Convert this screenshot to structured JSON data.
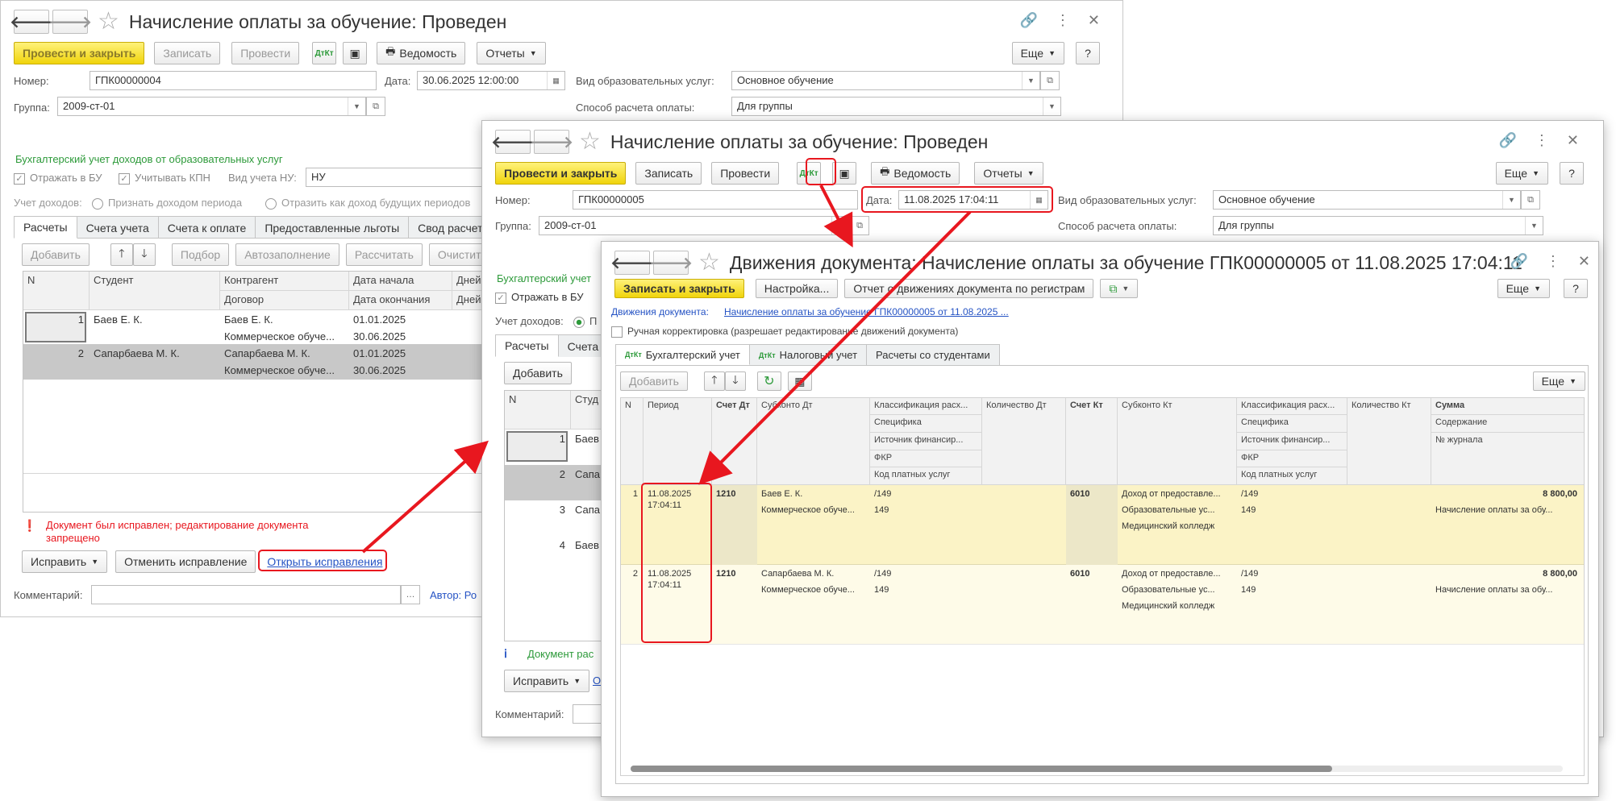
{
  "w1": {
    "title": "Начисление оплаты за обучение: Проведен",
    "btn_post_close": "Провести и закрыть",
    "btn_save": "Записать",
    "btn_post": "Провести",
    "btn_ved": "Ведомость",
    "btn_reports": "Отчеты",
    "btn_more": "Еще",
    "btn_help": "?",
    "lbl_number": "Номер:",
    "number": "ГПК00000004",
    "lbl_date": "Дата:",
    "date": "30.06.2025 12:00:00",
    "lbl_service": "Вид образовательных услуг:",
    "service": "Основное обучение",
    "lbl_group": "Группа:",
    "group": "2009-ст-01",
    "lbl_pay": "Способ расчета оплаты:",
    "pay": "Для группы",
    "section": "Бухгалтерский учет доходов от образовательных услуг",
    "chk_bu": "Отражать в БУ",
    "chk_kpn": "Учитывать КПН",
    "lbl_nu": "Вид учета НУ:",
    "nu": "НУ",
    "lbl_income": "Учет доходов:",
    "radio1": "Признать доходом периода",
    "radio2": "Отразить как доход будущих периодов",
    "tabs": [
      "Расчеты",
      "Счета учета",
      "Счета к оплате",
      "Предоставленные льготы",
      "Свод расчетов"
    ],
    "grid_btns": [
      "Добавить",
      "Подбор",
      "Автозаполнение",
      "Рассчитать",
      "Очистить"
    ],
    "cols": {
      "n": "N",
      "student": "Студент",
      "contr": "Контрагент",
      "contract": "Договор",
      "start": "Дата начала",
      "end": "Дата окончания",
      "days": "Дней"
    },
    "rows": [
      {
        "n": "1",
        "student": "Баев Е. К.",
        "contr": "Баев Е. К.",
        "contract": "Коммерческое обуче...",
        "start": "01.01.2025",
        "end": "30.06.2025"
      },
      {
        "n": "2",
        "student": "Сапарбаева М. К.",
        "contr": "Сапарбаева М. К.",
        "contract": "Коммерческое обуче...",
        "start": "01.01.2025",
        "end": "30.06.2025"
      }
    ],
    "warning": "Документ был исправлен; редактирование документа запрещено",
    "btn_fix": "Исправить",
    "btn_cancel_fix": "Отменить исправление",
    "link_open_fix": "Открыть исправления",
    "lbl_comment": "Комментарий:",
    "author": "Автор: Ро"
  },
  "w2": {
    "title": "Начисление оплаты за обучение: Проведен",
    "btn_post_close": "Провести и закрыть",
    "btn_save": "Записать",
    "btn_post": "Провести",
    "btn_ved": "Ведомость",
    "btn_reports": "Отчеты",
    "btn_more": "Еще",
    "btn_help": "?",
    "lbl_number": "Номер:",
    "number": "ГПК00000005",
    "lbl_date": "Дата:",
    "date": "11.08.2025 17:04:11",
    "lbl_service": "Вид образовательных услуг:",
    "service": "Основное обучение",
    "lbl_group": "Группа:",
    "group": "2009-ст-01",
    "lbl_pay": "Способ расчета оплаты:",
    "pay": "Для группы",
    "section": "Бухгалтерский учет",
    "chk_bu": "Отражать в БУ",
    "lbl_income": "Учет доходов:",
    "radio_short": "П",
    "tabs": [
      "Расчеты",
      "Счета"
    ],
    "btn_add": "Добавить",
    "col_n": "N",
    "col_student": "Студ",
    "rows": [
      {
        "n": "1",
        "s": "Баев"
      },
      {
        "n": "2",
        "s": "Сапа"
      },
      {
        "n": "3",
        "s": "Сапа"
      },
      {
        "n": "4",
        "s": "Баев"
      }
    ],
    "info": "Документ рас",
    "btn_fix": "Исправить",
    "link_short": "О",
    "lbl_comment": "Комментарий:"
  },
  "w3": {
    "title": "Движения документа: Начисление оплаты за обучение ГПК00000005 от 11.08.2025 17:04:11",
    "btn_write_close": "Записать и закрыть",
    "btn_settings": "Настройка...",
    "btn_report": "Отчет о движениях документа по регистрам",
    "btn_more": "Еще",
    "btn_help": "?",
    "lbl_moves": "Движения документа:",
    "link_doc": "Начисление оплаты за обучение ГПК00000005 от 11.08.2025 ...",
    "manual": "Ручная корректировка (разрешает редактирование движений документа)",
    "tabs": [
      "Бухгалтерский учет",
      "Налоговый учет",
      "Расчеты со студентами"
    ],
    "btn_add": "Добавить",
    "cols": {
      "n": "N",
      "period": "Период",
      "acc_dt": "Счет Дт",
      "sub_dt": "Субконто Дт",
      "class_dt": "Классификация расх...",
      "spec": "Специфика",
      "source": "Источник финансир...",
      "fkr": "ФКР",
      "code": "Код платных услуг",
      "qty_dt": "Количество Дт",
      "acc_kt": "Счет Кт",
      "sub_kt": "Субконто Кт",
      "class_kt": "Классификация расх...",
      "spec_kt": "Специфика",
      "source_kt": "Источник финансир...",
      "fkr_kt": "ФКР",
      "code_kt": "Код платных услуг",
      "qty_kt": "Количество Кт",
      "sum": "Сумма",
      "content": "Содержание",
      "journal": "№ журнала"
    },
    "rows": [
      {
        "n": "1",
        "period1": "11.08.2025",
        "period2": "17:04:11",
        "acc_dt": "1210",
        "sub_dt1": "Баев Е. К.",
        "sub_dt2": "Коммерческое обуче...",
        "cl_dt1": "/149",
        "cl_dt2": "149",
        "acc_kt": "6010",
        "sub_kt1": "Доход от предоставле...",
        "sub_kt2": "Образовательные ус...",
        "sub_kt3": "Медицинский колледж",
        "cl_kt1": "/149",
        "cl_kt2": "149",
        "sum": "8 800,00",
        "content": "Начисление оплаты за обу..."
      },
      {
        "n": "2",
        "period1": "11.08.2025",
        "period2": "17:04:11",
        "acc_dt": "1210",
        "sub_dt1": "Сапарбаева М. К.",
        "sub_dt2": "Коммерческое обуче...",
        "cl_dt1": "/149",
        "cl_dt2": "149",
        "acc_kt": "6010",
        "sub_kt1": "Доход от предоставле...",
        "sub_kt2": "Образовательные ус...",
        "sub_kt3": "Медицинский колледж",
        "cl_kt1": "/149",
        "cl_kt2": "149",
        "sum": "8 800,00",
        "content": "Начисление оплаты за обу..."
      }
    ]
  },
  "colors": {
    "highlight": "#e8171f",
    "yellow_btn": "#f0d40c",
    "green_text": "#2d9a3a",
    "row_yellow": "#fbf3c6",
    "row_gray": "#c8c8c8"
  }
}
